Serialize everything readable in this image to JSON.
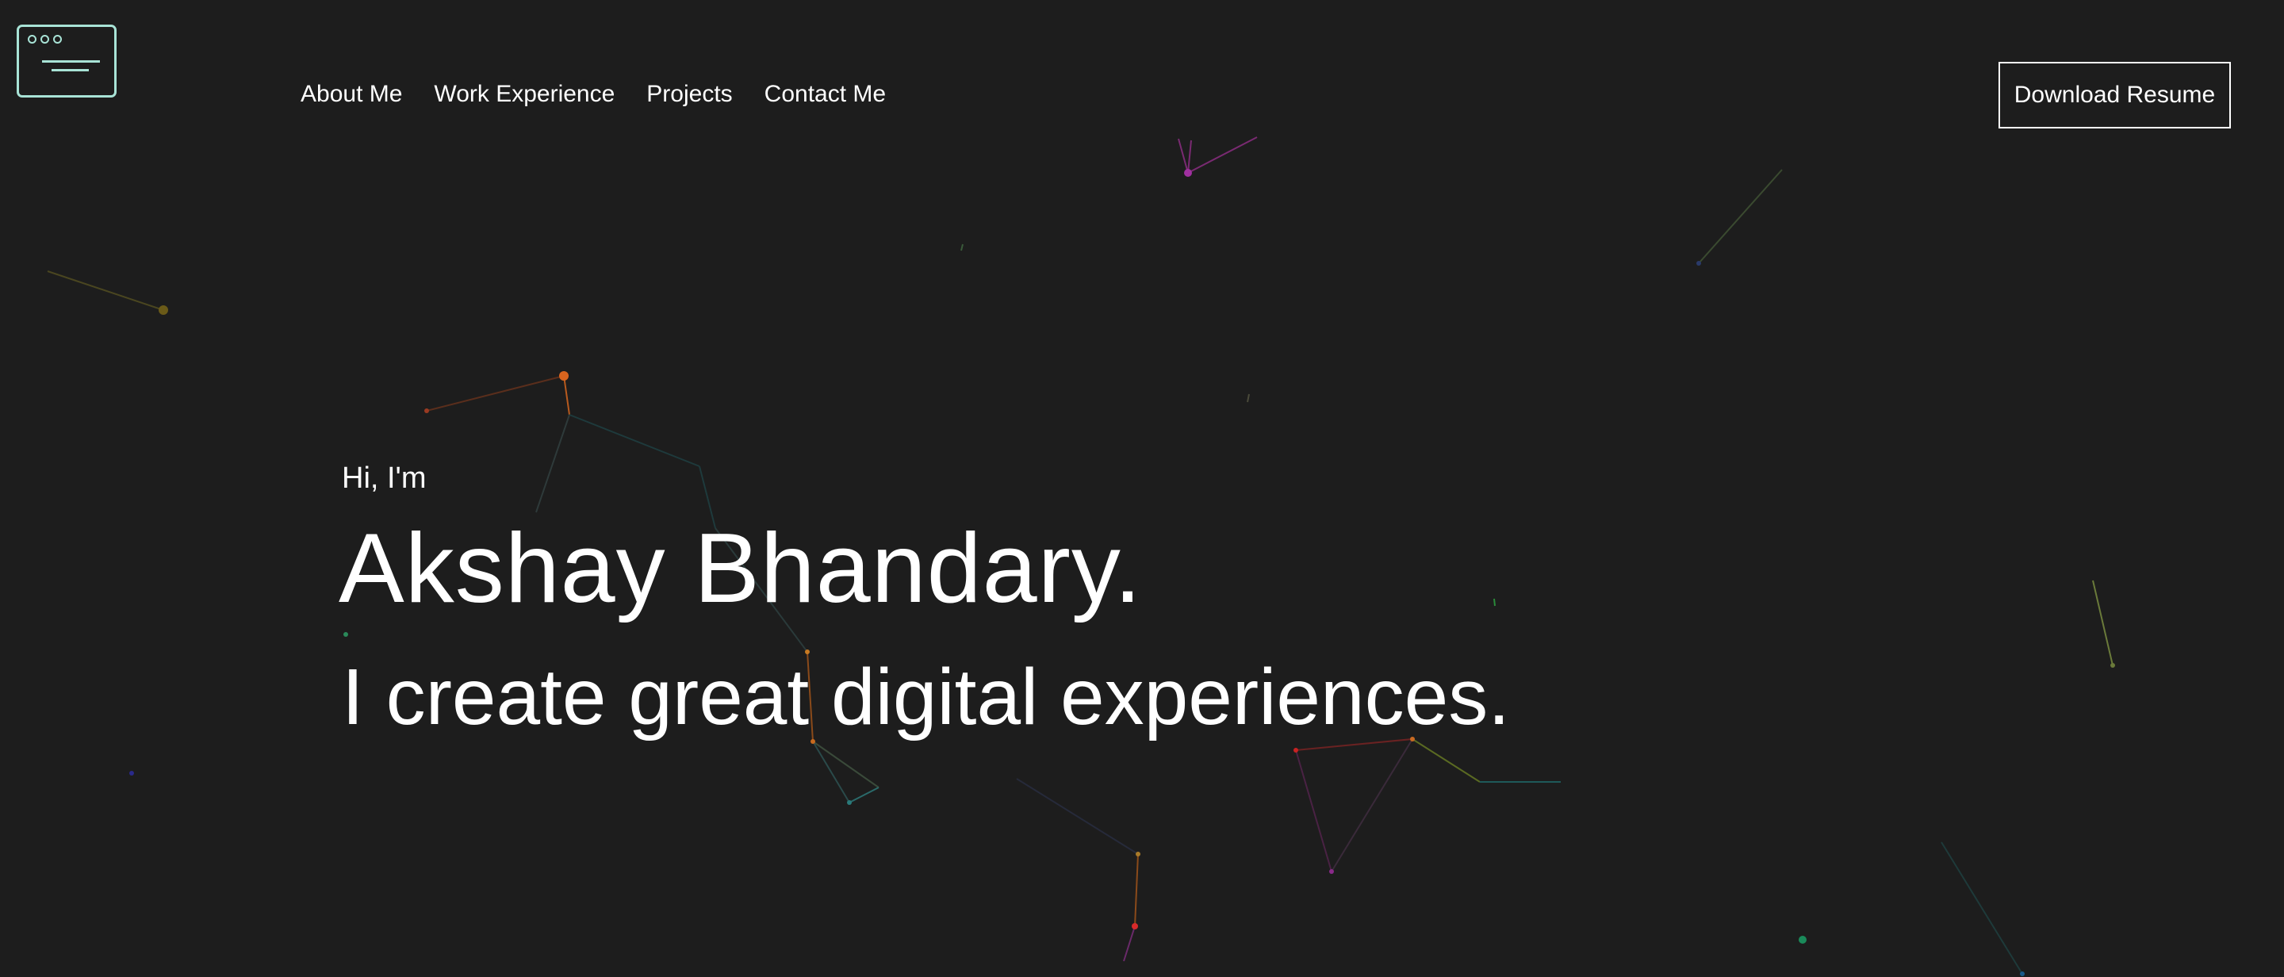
{
  "header": {
    "logo_icon": "browser-window-icon",
    "logo_color": "#a8e3d6",
    "nav": [
      {
        "label": "About Me"
      },
      {
        "label": "Work Experience"
      },
      {
        "label": "Projects"
      },
      {
        "label": "Contact Me"
      }
    ],
    "resume_button": "Download Resume"
  },
  "hero": {
    "greeting": "Hi, I'm",
    "name": "Akshay Bhandary.",
    "tagline": "I create great digital experiences."
  },
  "theme": {
    "background": "#1d1d1d",
    "text": "#ffffff"
  }
}
